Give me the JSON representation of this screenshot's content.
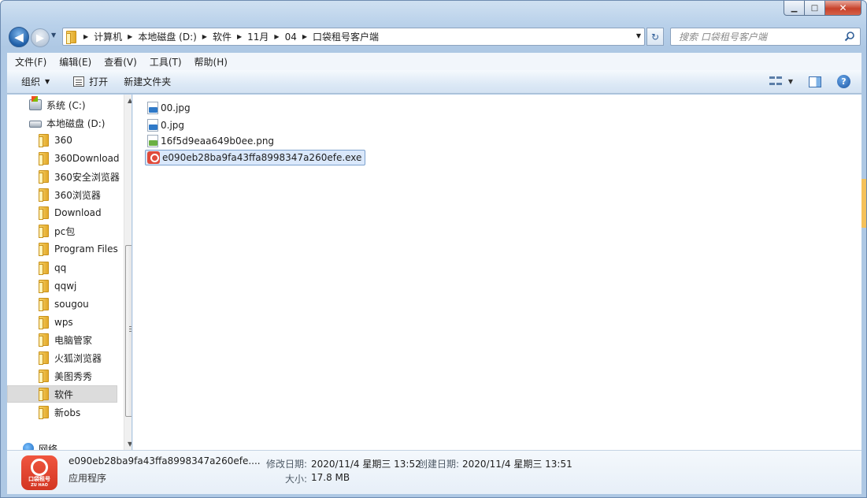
{
  "window": {
    "caption": {
      "minimize": "▁",
      "maximize": "□",
      "close": "✕"
    }
  },
  "nav": {
    "back_glyph": "◀",
    "forward_glyph": "▶",
    "breadcrumb": [
      "计算机",
      "本地磁盘 (D:)",
      "软件",
      "11月",
      "04",
      "口袋租号客户端"
    ],
    "search_placeholder": "搜索 口袋租号客户端"
  },
  "menubar": {
    "items": [
      "文件(F)",
      "编辑(E)",
      "查看(V)",
      "工具(T)",
      "帮助(H)"
    ]
  },
  "toolbar": {
    "organize": "组织",
    "open": "打开",
    "new_folder": "新建文件夹",
    "help": "?"
  },
  "tree": {
    "items": [
      {
        "label": "系统 (C:)",
        "icon": "drive-c-icon"
      },
      {
        "label": "本地磁盘 (D:)",
        "icon": "drive-d-icon"
      },
      {
        "label": "360",
        "icon": "folder-icon"
      },
      {
        "label": "360Download",
        "icon": "folder-icon"
      },
      {
        "label": "360安全浏览器",
        "icon": "folder-icon"
      },
      {
        "label": "360浏览器",
        "icon": "folder-icon"
      },
      {
        "label": "Download",
        "icon": "folder-icon"
      },
      {
        "label": "pc包",
        "icon": "folder-icon"
      },
      {
        "label": "Program Files",
        "icon": "folder-icon"
      },
      {
        "label": "qq",
        "icon": "folder-icon"
      },
      {
        "label": "qqwj",
        "icon": "folder-icon"
      },
      {
        "label": "sougou",
        "icon": "folder-icon"
      },
      {
        "label": "wps",
        "icon": "folder-icon"
      },
      {
        "label": "电脑管家",
        "icon": "folder-icon"
      },
      {
        "label": "火狐浏览器",
        "icon": "folder-icon"
      },
      {
        "label": "美图秀秀",
        "icon": "folder-icon"
      },
      {
        "label": "软件",
        "icon": "folder-icon",
        "selected": true
      },
      {
        "label": "新obs",
        "icon": "folder-icon"
      },
      {
        "label": "网络",
        "icon": "network-icon"
      }
    ]
  },
  "files": [
    {
      "name": "00.jpg",
      "icon": "jpg-file-icon"
    },
    {
      "name": "0.jpg",
      "icon": "jpg-file-icon"
    },
    {
      "name": "16f5d9eaa649b0ee.png",
      "icon": "png-file-icon"
    },
    {
      "name": "e090eb28ba9fa43ffa8998347a260efe.exe",
      "icon": "exe-file-icon",
      "selected": true
    }
  ],
  "details": {
    "name": "e090eb28ba9fa43ffa8998347a260efe....",
    "type": "应用程序",
    "modified_label": "修改日期:",
    "modified_value": "2020/11/4 星期三 13:52",
    "created_label": "创建日期:",
    "created_value": "2020/11/4 星期三 13:51",
    "size_label": "大小:",
    "size_value": "17.8 MB",
    "logo_text": "口袋租号",
    "logo_subtext": "ZU HAO"
  }
}
